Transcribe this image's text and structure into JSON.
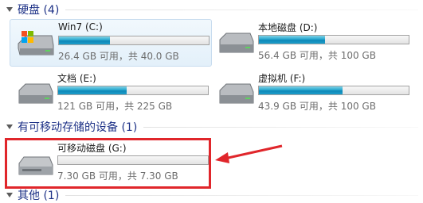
{
  "groups": [
    {
      "title": "硬盘 (4)"
    },
    {
      "title": "有可移动存储的设备 (1)"
    },
    {
      "title": "其他 (1)"
    }
  ],
  "drives": [
    {
      "name": "Win7 (C:)",
      "info": "26.4 GB 可用，共 40.0 GB",
      "used_fraction": 0.34,
      "icon": "system-drive-icon"
    },
    {
      "name": "本地磁盘 (D:)",
      "info": "56.4 GB 可用，共 100 GB",
      "used_fraction": 0.44,
      "icon": "hard-drive-icon"
    },
    {
      "name": "文档 (E:)",
      "info": "121 GB 可用，共 225 GB",
      "used_fraction": 0.46,
      "icon": "hard-drive-icon"
    },
    {
      "name": "虚拟机 (F:)",
      "info": "43.9 GB 可用，共 100 GB",
      "used_fraction": 0.56,
      "icon": "hard-drive-icon"
    },
    {
      "name": "可移动磁盘 (G:)",
      "info": "7.30 GB 可用，共 7.30 GB",
      "used_fraction": 0.0,
      "icon": "removable-drive-icon"
    }
  ],
  "colors": {
    "bar_fill": "#1d9ecb",
    "group_title": "#1e3287",
    "callout": "#e0262b"
  }
}
